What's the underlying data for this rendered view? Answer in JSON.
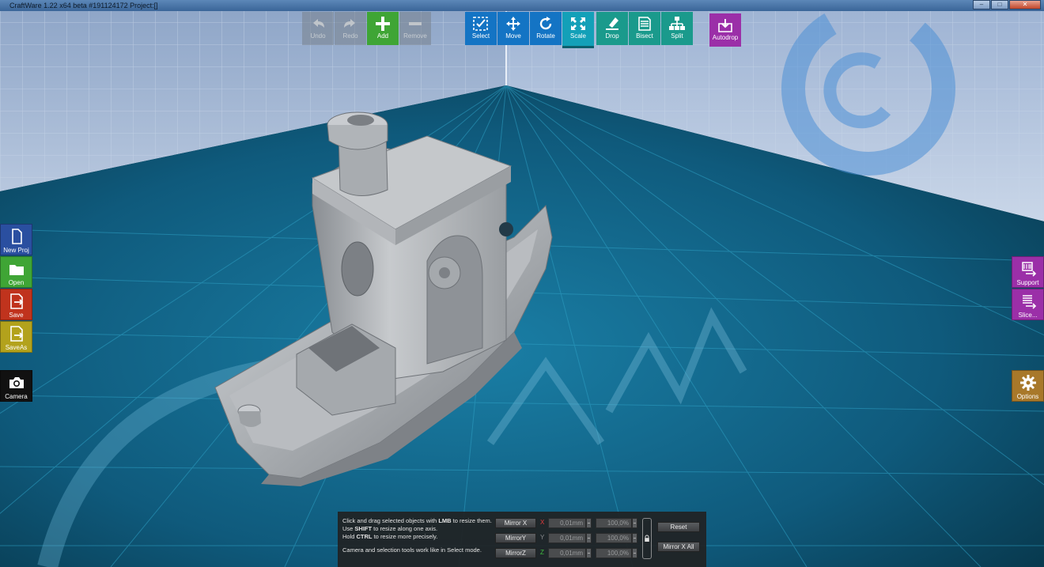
{
  "window": {
    "title": "CraftWare 1.22 x64 beta #191124172   Project:[]",
    "min": "–",
    "max": "□",
    "close": "✕"
  },
  "toolbar": {
    "edit": [
      {
        "label": "Undo",
        "icon": "undo-icon",
        "enabled": false
      },
      {
        "label": "Redo",
        "icon": "redo-icon",
        "enabled": false
      },
      {
        "label": "Add",
        "icon": "plus-icon",
        "enabled": true
      },
      {
        "label": "Remove",
        "icon": "minus-icon",
        "enabled": false
      }
    ],
    "tools": [
      {
        "label": "Select",
        "icon": "select-icon"
      },
      {
        "label": "Move",
        "icon": "move-icon"
      },
      {
        "label": "Rotate",
        "icon": "rotate-icon"
      },
      {
        "label": "Scale",
        "icon": "scale-icon",
        "active": true
      },
      {
        "label": "Drop",
        "icon": "drop-icon"
      },
      {
        "label": "Bisect",
        "icon": "bisect-icon"
      },
      {
        "label": "Split",
        "icon": "split-icon"
      }
    ],
    "autodrop": {
      "label": "Autodrop",
      "icon": "autodrop-icon"
    }
  },
  "left_sidebar": [
    {
      "label": "New Proj",
      "icon": "new-file-icon"
    },
    {
      "label": "Open",
      "icon": "folder-icon"
    },
    {
      "label": "Save",
      "icon": "save-icon"
    },
    {
      "label": "SaveAs",
      "icon": "save-as-icon"
    },
    {
      "label": "Camera",
      "icon": "camera-icon"
    }
  ],
  "right_sidebar": [
    {
      "label": "Support",
      "icon": "support-icon"
    },
    {
      "label": "Slice...",
      "icon": "slice-icon"
    },
    {
      "label": "Options",
      "icon": "gear-icon"
    }
  ],
  "scale_panel": {
    "help_lines": [
      [
        "Click and drag selected objects with ",
        "LMB",
        " to resize them."
      ],
      [
        "Use ",
        "SHIFT",
        " to resize along one axis."
      ],
      [
        "Hold ",
        "CTRL",
        " to resize more precisely."
      ]
    ],
    "help_note": "Camera and selection tools work like in Select mode.",
    "rows": [
      {
        "mirror": "Mirror X",
        "axis": "X",
        "axis_color": "#e23b3b",
        "size": "0,01mm",
        "percent": "100,0%"
      },
      {
        "mirror": "MirrorY",
        "axis": "Y",
        "axis_color": "#8a8c8e",
        "size": "0,01mm",
        "percent": "100,0%"
      },
      {
        "mirror": "MirrorZ",
        "axis": "Z",
        "axis_color": "#3fbf3f",
        "size": "0,01mm",
        "percent": "100,0%"
      }
    ],
    "lock_icon": "lock-icon",
    "reset": "Reset",
    "mirror_all": "Mirror X All"
  }
}
